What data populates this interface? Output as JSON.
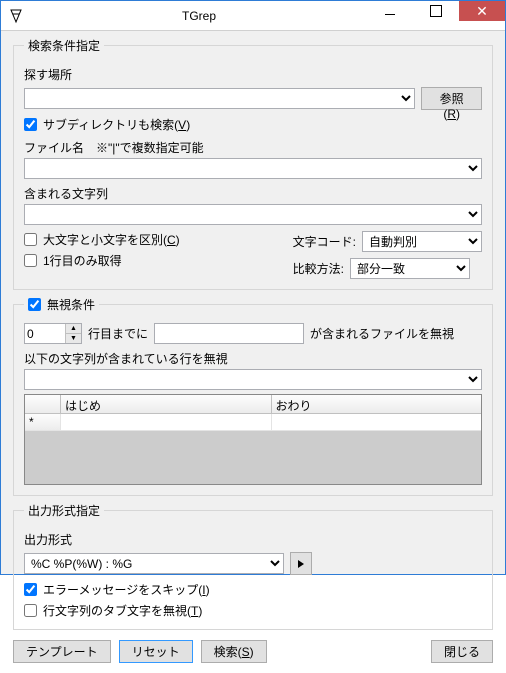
{
  "window": {
    "title": "TGrep"
  },
  "search": {
    "legend": "検索条件指定",
    "place_label": "探す場所",
    "place_value": "",
    "browse_label_pre": "参照(",
    "browse_mnemonic": "R",
    "browse_label_post": ")",
    "subdir_label_pre": "サブディレクトリも検索(",
    "subdir_mnemonic": "V",
    "subdir_label_post": ")",
    "subdir_checked": true,
    "filename_label": "ファイル名　※\"|\"で複数指定可能",
    "filename_value": "",
    "contains_label": "含まれる文字列",
    "contains_value": "",
    "case_label_pre": "大文字と小文字を区別(",
    "case_mnemonic": "C",
    "case_label_post": ")",
    "case_checked": false,
    "firstline_label": "1行目のみ取得",
    "firstline_checked": false,
    "charcode_label": "文字コード:",
    "charcode_value": "自動判別",
    "compare_label": "比較方法:",
    "compare_value": "部分一致"
  },
  "ignore": {
    "legend": "無視条件",
    "legend_checked": true,
    "lines_value": "0",
    "lines_suffix": "行目までに",
    "pattern_value": "",
    "pattern_suffix": "が含まれるファイルを無視",
    "rows_label": "以下の文字列が含まれている行を無視",
    "grid": {
      "col0": "",
      "col1": "はじめ",
      "col2": "おわり",
      "newrow_marker": "*"
    }
  },
  "output": {
    "legend": "出力形式指定",
    "format_label": "出力形式",
    "format_value": "%C %P(%W) : %G",
    "skip_err_label_pre": "エラーメッセージをスキップ(",
    "skip_err_mnemonic": "I",
    "skip_err_label_post": ")",
    "skip_err_checked": true,
    "ignore_tab_label_pre": "行文字列のタブ文字を無視(",
    "ignore_tab_mnemonic": "T",
    "ignore_tab_label_post": ")",
    "ignore_tab_checked": false
  },
  "buttons": {
    "template": "テンプレート",
    "reset": "リセット",
    "search_pre": "検索(",
    "search_mnemonic": "S",
    "search_post": ")",
    "close": "閉じる"
  }
}
